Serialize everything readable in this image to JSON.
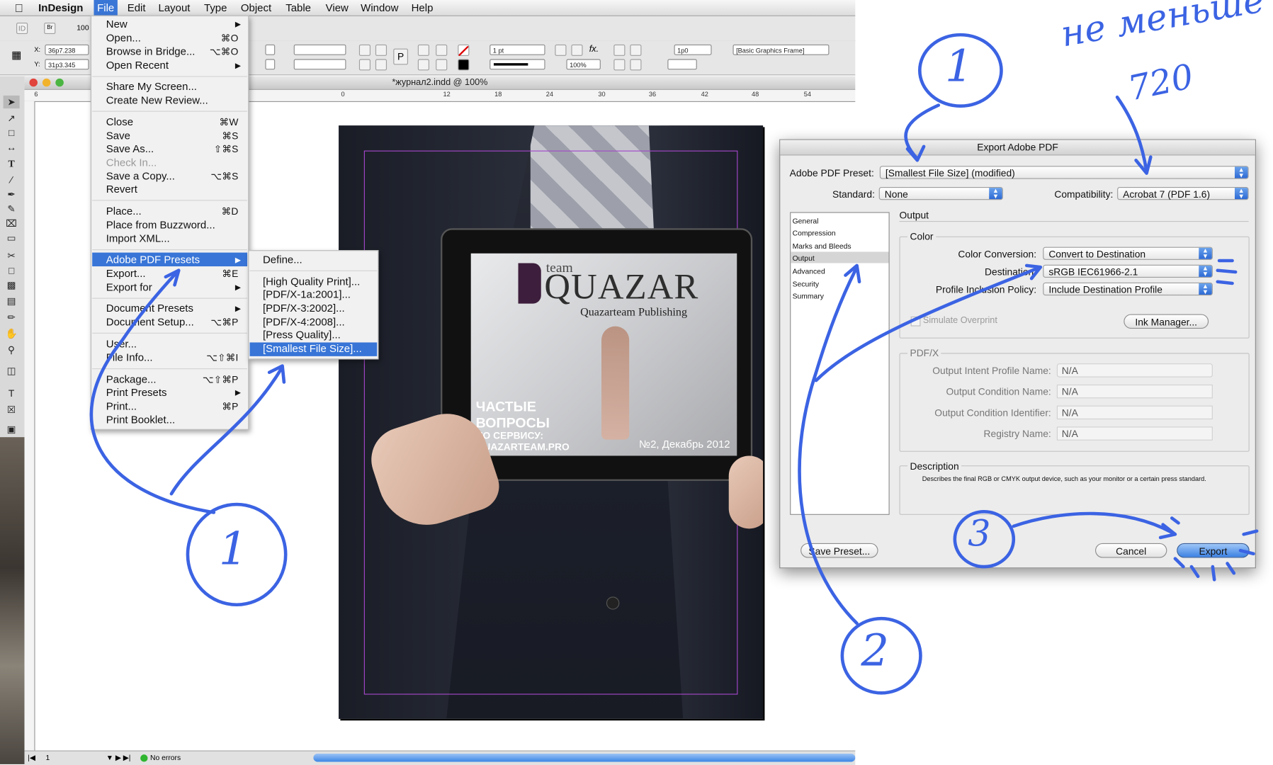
{
  "menubar": {
    "app": "InDesign",
    "items": [
      "File",
      "Edit",
      "Layout",
      "Type",
      "Object",
      "Table",
      "View",
      "Window",
      "Help"
    ]
  },
  "control": {
    "x": "36p7.238",
    "y": "31p3.345",
    "stroke_weight": "1 pt",
    "opacity": "100%",
    "corner": "1p0",
    "object_style": "[Basic Graphics Frame]",
    "zoom": "100"
  },
  "doc": {
    "title": "*журнал2.indd @ 100%"
  },
  "ruler_ticks": [
    "6",
    "12",
    "18",
    "24",
    "30",
    "36",
    "42",
    "48",
    "54",
    "0",
    "12",
    "18",
    "24",
    "30",
    "36",
    "42",
    "48",
    "54"
  ],
  "file_menu": {
    "items": [
      {
        "label": "New",
        "shortcut": "",
        "submenu": true
      },
      {
        "label": "Open...",
        "shortcut": "⌘O"
      },
      {
        "label": "Browse in Bridge...",
        "shortcut": "⌥⌘O"
      },
      {
        "label": "Open Recent",
        "shortcut": "",
        "submenu": true
      },
      {
        "label": "Share My Screen...",
        "shortcut": ""
      },
      {
        "label": "Create New Review...",
        "shortcut": ""
      },
      {
        "label": "Close",
        "shortcut": "⌘W"
      },
      {
        "label": "Save",
        "shortcut": "⌘S"
      },
      {
        "label": "Save As...",
        "shortcut": "⇧⌘S"
      },
      {
        "label": "Check In...",
        "shortcut": "",
        "disabled": true
      },
      {
        "label": "Save a Copy...",
        "shortcut": "⌥⌘S"
      },
      {
        "label": "Revert",
        "shortcut": ""
      },
      {
        "label": "Place...",
        "shortcut": "⌘D"
      },
      {
        "label": "Place from Buzzword...",
        "shortcut": ""
      },
      {
        "label": "Import XML...",
        "shortcut": ""
      },
      {
        "label": "Adobe PDF Presets",
        "shortcut": "",
        "submenu": true,
        "highlighted": true
      },
      {
        "label": "Export...",
        "shortcut": "⌘E"
      },
      {
        "label": "Export for",
        "shortcut": "",
        "submenu": true
      },
      {
        "label": "Document Presets",
        "shortcut": "",
        "submenu": true
      },
      {
        "label": "Document Setup...",
        "shortcut": "⌥⌘P"
      },
      {
        "label": "User...",
        "shortcut": ""
      },
      {
        "label": "File Info...",
        "shortcut": "⌥⇧⌘I"
      },
      {
        "label": "Package...",
        "shortcut": "⌥⇧⌘P"
      },
      {
        "label": "Print Presets",
        "shortcut": "",
        "submenu": true
      },
      {
        "label": "Print...",
        "shortcut": "⌘P"
      },
      {
        "label": "Print Booklet...",
        "shortcut": ""
      }
    ]
  },
  "presets_menu": {
    "items": [
      "Define...",
      "[High Quality Print]...",
      "[PDF/X-1a:2001]...",
      "[PDF/X-3:2002]...",
      "[PDF/X-4:2008]...",
      "[Press Quality]...",
      "[Smallest File Size]..."
    ]
  },
  "cover": {
    "team": "team",
    "brand": "QUAZAR",
    "publisher": "Quazarteam Publishing",
    "heading_line1": "ЧАСТЫЕ",
    "heading_line2": "ВОПРОСЫ",
    "sub_line1": "ПО СЕРВИСУ:",
    "sub_line2": "QUAZARTEAM.PRO",
    "issue": "№2, Декабрь 2012"
  },
  "dialog": {
    "title": "Export Adobe PDF",
    "preset_label": "Adobe PDF Preset:",
    "preset_value": "[Smallest File Size] (modified)",
    "standard_label": "Standard:",
    "standard_value": "None",
    "compat_label": "Compatibility:",
    "compat_value": "Acrobat 7 (PDF 1.6)",
    "sections": [
      "General",
      "Compression",
      "Marks and Bleeds",
      "Output",
      "Advanced",
      "Security",
      "Summary"
    ],
    "active_section": "Output",
    "output_heading": "Output",
    "color_group": "Color",
    "color_conversion_label": "Color Conversion:",
    "color_conversion_value": "Convert to Destination",
    "destination_label": "Destination:",
    "destination_value": "sRGB IEC61966-2.1",
    "profile_label": "Profile Inclusion Policy:",
    "profile_value": "Include Destination Profile",
    "simulate": "Simulate Overprint",
    "ink_manager": "Ink Manager...",
    "pdfx_group": "PDF/X",
    "intent_label": "Output Intent Profile Name:",
    "intent_value": "N/A",
    "condition_name_label": "Output Condition Name:",
    "condition_name_value": "N/A",
    "condition_id_label": "Output Condition Identifier:",
    "condition_id_value": "N/A",
    "registry_label": "Registry Name:",
    "registry_value": "N/A",
    "description_group": "Description",
    "description_text": "Describes the final RGB or CMYK output device, such as your monitor or a certain press standard.",
    "save_preset": "Save Preset...",
    "cancel": "Cancel",
    "export": "Export"
  },
  "status": {
    "page": "1",
    "errors": "No errors"
  },
  "annotations": {
    "note_line1": "не меньше",
    "note_line2": "720",
    "marks": [
      "1",
      "1",
      "2",
      "3"
    ],
    "ink_color": "#3b63e3"
  }
}
